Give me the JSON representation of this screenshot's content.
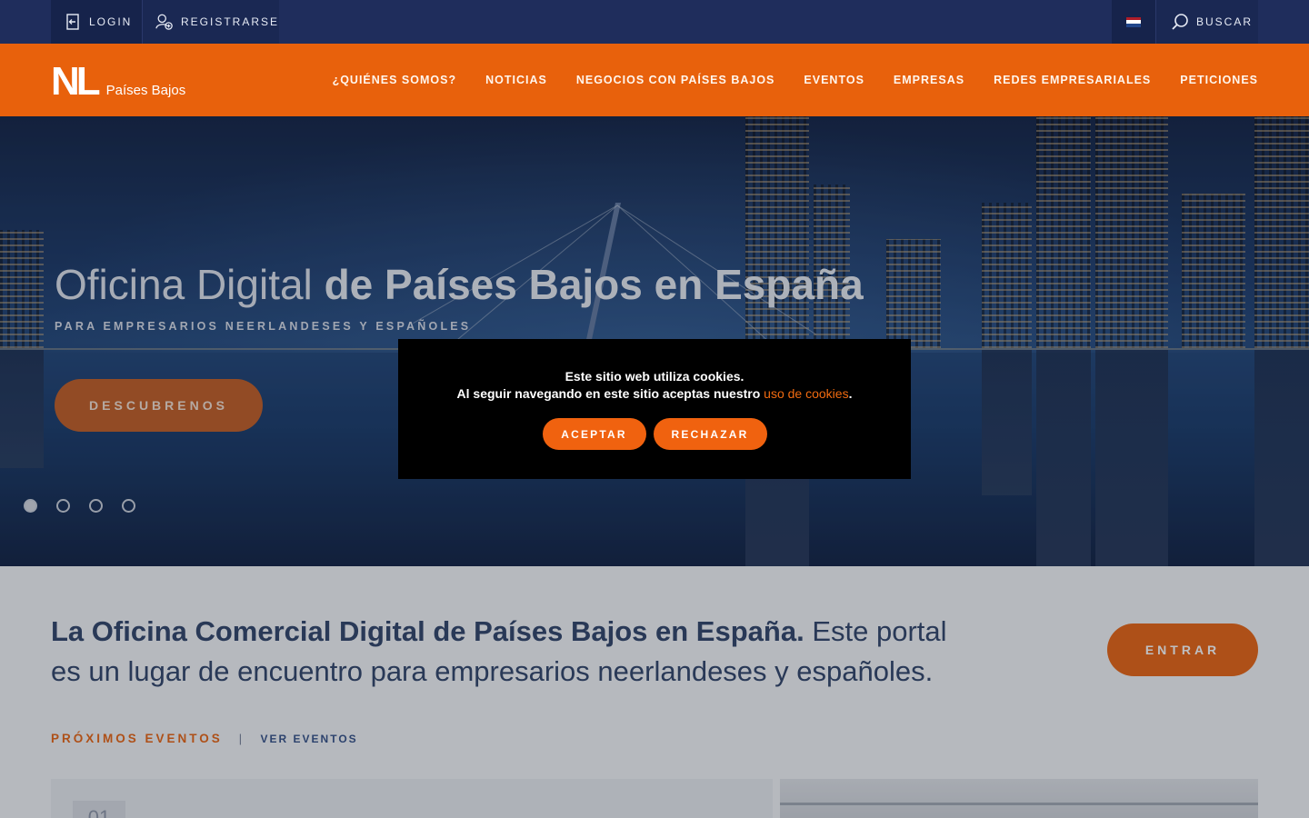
{
  "topbar": {
    "login": "LOGIN",
    "register": "REGISTRARSE",
    "search": "BUSCAR",
    "flag_colors": [
      "#ae1c28",
      "#ffffff",
      "#21468b"
    ]
  },
  "nav": {
    "logo_mark": "NL",
    "logo_text": "Países Bajos",
    "items": [
      "¿QUIÉNES SOMOS?",
      "NOTICIAS",
      "NEGOCIOS CON PAÍSES BAJOS",
      "EVENTOS",
      "EMPRESAS",
      "REDES EMPRESARIALES",
      "PETICIONES"
    ]
  },
  "hero": {
    "title_light": "Oficina Digital",
    "title_bold": "de Países Bajos en España",
    "subtitle": "PARA EMPRESARIOS NEERLANDESES Y ESPAÑOLES",
    "button": "DESCUBRENOS",
    "slides": 4,
    "active_slide": 1
  },
  "content": {
    "intro_bold": "La Oficina Comercial Digital de Países Bajos en España.",
    "intro_rest": "Este portal es un lugar de encuentro para empresarios neerlandeses y españoles.",
    "enter_button": "ENTRAR",
    "events_title": "PRÓXIMOS EVENTOS",
    "events_sep": "|",
    "events_link": "VER EVENTOS",
    "card_date": "01"
  },
  "cookie": {
    "line1": "Este sitio web utiliza cookies.",
    "line2": "Al seguir navegando en este sitio aceptas nuestro",
    "link": "uso de cookies",
    "period": ".",
    "accept": "ACEPTAR",
    "reject": "RECHAZAR"
  },
  "colors": {
    "brand_orange": "#e8610c",
    "navy": "#1f2d5c",
    "text_navy": "#2a3f66"
  }
}
